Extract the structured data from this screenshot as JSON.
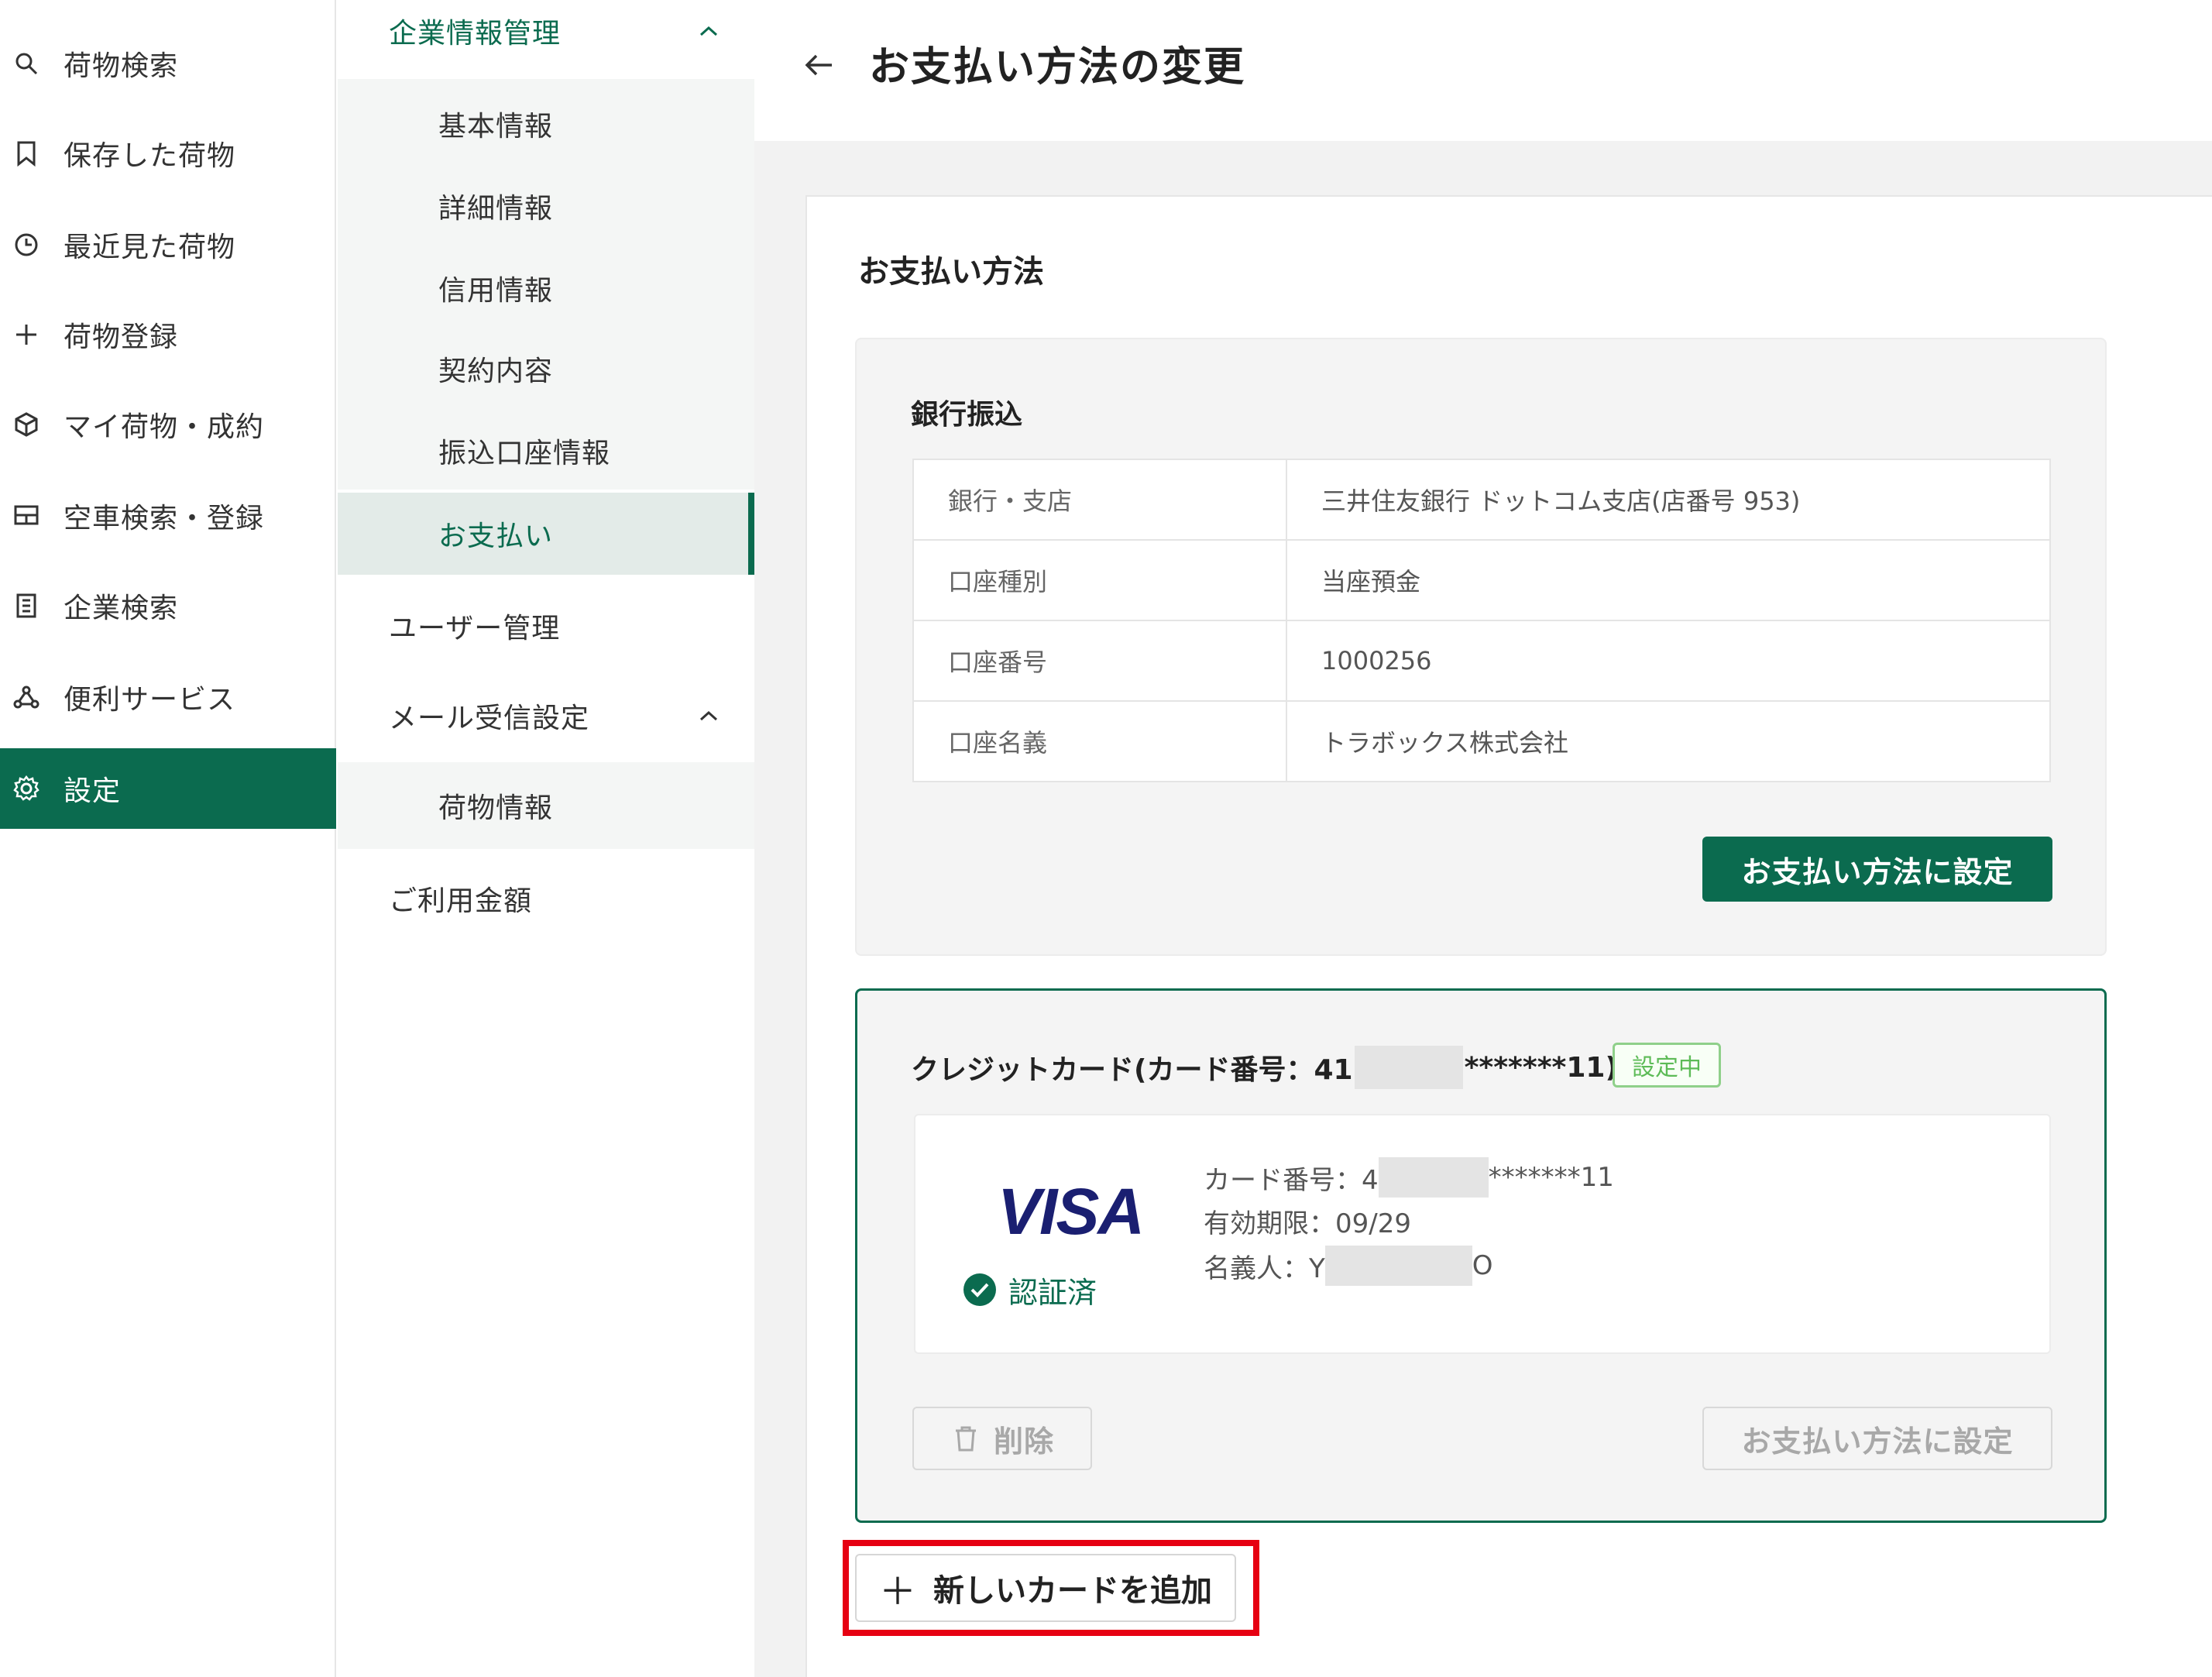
{
  "nav": {
    "items": [
      {
        "label": "荷物検索",
        "icon": "search-icon"
      },
      {
        "label": "保存した荷物",
        "icon": "bookmark-icon"
      },
      {
        "label": "最近見た荷物",
        "icon": "history-icon"
      },
      {
        "label": "荷物登録",
        "icon": "plus-icon"
      },
      {
        "label": "マイ荷物・成約",
        "icon": "box-icon"
      },
      {
        "label": "空車検索・登録",
        "icon": "truck-icon"
      },
      {
        "label": "企業検索",
        "icon": "building-icon"
      },
      {
        "label": "便利サービス",
        "icon": "network-icon"
      },
      {
        "label": "設定",
        "icon": "gear-icon",
        "active": true
      }
    ]
  },
  "settings_menu": {
    "company_group": "企業情報管理",
    "company_items": [
      "基本情報",
      "詳細情報",
      "信用情報",
      "契約内容",
      "振込口座情報",
      "お支払い"
    ],
    "user_management": "ユーザー管理",
    "mail_group": "メール受信設定",
    "mail_items": [
      "荷物情報"
    ],
    "usage_fee": "ご利用金額"
  },
  "header": {
    "title": "お支払い方法の変更"
  },
  "payment": {
    "section_title": "お支払い方法",
    "bank": {
      "title": "銀行振込",
      "rows": [
        {
          "key": "銀行・支店",
          "value": "三井住友銀行 ドットコム支店(店番号 953)"
        },
        {
          "key": "口座種別",
          "value": "当座預金"
        },
        {
          "key": "口座番号",
          "value": "1000256"
        },
        {
          "key": "口座名義",
          "value": "トラボックス株式会社"
        }
      ],
      "set_button": "お支払い方法に設定"
    },
    "credit": {
      "title_prefix": "クレジットカード(カード番号：41",
      "title_suffix": "*******11)",
      "status_badge": "設定中",
      "brand": "VISA",
      "verified": "認証済",
      "card_number_prefix": "カード番号：4",
      "card_number_suffix": "*******11",
      "expiry": "有効期限：09/29",
      "holder_prefix": "名義人：Y",
      "holder_suffix": "O",
      "delete_button": "削除",
      "set_button": "お支払い方法に設定"
    },
    "add_card_button": "新しいカードを追加"
  },
  "colors": {
    "brand_green": "#0b6b4f",
    "badge_green": "#5dbb57",
    "highlight_red": "#e60012",
    "visa_blue": "#1a1f71"
  }
}
